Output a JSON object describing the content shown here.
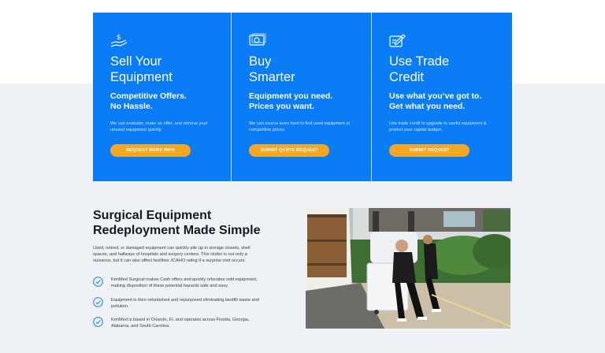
{
  "cards": [
    {
      "icon": "money-hand-icon",
      "title": "Sell Your\nEquipment",
      "subtitle": "Competitive Offers.\nNo Hassle.",
      "description": "We can evaluate, make an offer, and remove your unused equipment quickly.",
      "button": "REQUEST MORE INFO"
    },
    {
      "icon": "cash-icon",
      "title": "Buy\nSmarter",
      "subtitle": "Equipment you need.\nPrices you want.",
      "description": "We can source even hard to find used equipment at competitive prices.",
      "button": "SUBMIT QUOTE REQUEST"
    },
    {
      "icon": "edit-icon",
      "title": "Use Trade\nCredit",
      "subtitle": "Use what you’ve got to.\nGet what you need.",
      "description": "Use trade credit to upgrade to useful equipment & protect your capital budget.",
      "button": "SUBMIT REQUEST"
    }
  ],
  "section": {
    "heading": "Surgical Equipment\nRedeployment Made Simple",
    "intro": "Used, retired, or damaged equipment can quickly pile up in storage closets, shell spaces, and hallways of hospitals and surgery centers. This clutter is not only a nuisance, but it can also affect facilities JCAHO rating if a surprise visit occurs.",
    "points": [
      "KenMed Surgical makes Cash offers and quickly relocates sold equipment, making disposition of these potential hazards safe and easy.",
      "Equipment is then refurbished and repurposed eliminating landfill waste and pollution.",
      "KenMed is based in Orlando, FL and operates across Florida, Georgia, Alabama, and South Carolina."
    ]
  },
  "colors": {
    "card_blue": "#0a7cf6",
    "button_orange": "#f5a623",
    "check_blue": "#1f7fe0",
    "section_bg": "#eef1f5"
  }
}
